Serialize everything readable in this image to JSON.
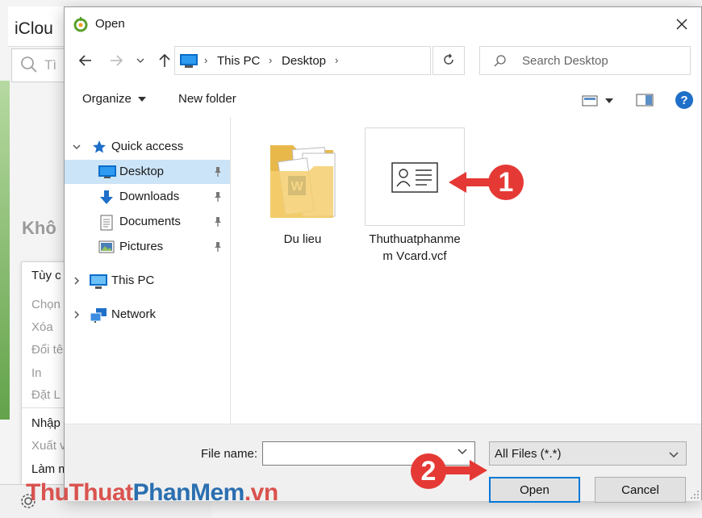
{
  "background": {
    "app_title": "iClou",
    "search_placeholder": "Tì",
    "empty_text": "Khô",
    "menu_items": [
      "Tùy c",
      "Chọn",
      "Xóa",
      "Đổi tê",
      "In",
      "Đặt L",
      "Nhập",
      "Xuất v",
      "Làm m"
    ]
  },
  "dialog": {
    "title": "Open",
    "breadcrumbs": [
      "This PC",
      "Desktop"
    ],
    "search_placeholder": "Search Desktop",
    "toolbar": {
      "organize": "Organize",
      "new_folder": "New folder"
    },
    "nav": {
      "quick_access": "Quick access",
      "desktop": "Desktop",
      "downloads": "Downloads",
      "documents": "Documents",
      "pictures": "Pictures",
      "this_pc": "This PC",
      "network": "Network"
    },
    "files": [
      {
        "name": "Du lieu",
        "icon": "folder-icon"
      },
      {
        "name": "Thuthuatphanmem Vcard.vcf",
        "name_line1": "Thuthuatphanme",
        "name_line2": "m Vcard.vcf",
        "icon": "vcard-icon"
      }
    ],
    "file_name_label": "File name:",
    "file_name_value": "",
    "file_type": "All Files (*.*)",
    "open_label": "Open",
    "cancel_label": "Cancel"
  },
  "annotations": {
    "step1": "1",
    "step2": "2"
  },
  "watermark": {
    "part1": "ThuThuat",
    "part2": "PhanMem",
    "part3": ".vn"
  },
  "colors": {
    "accent": "#0078d7",
    "selection": "#cce4f7",
    "badge": "#e53935"
  }
}
